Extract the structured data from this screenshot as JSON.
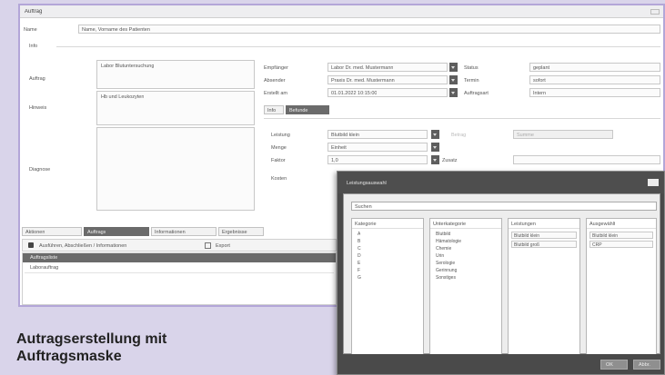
{
  "window": {
    "title": "Auftrag",
    "name_label": "Name",
    "name_value": "Name, Vorname des Patienten",
    "info_label": "Info",
    "auftrag_label": "Auftrag",
    "auftrag_value": "Labor Blutuntersuchung",
    "hinweis_label": "Hinweis",
    "hinweis_value": "Hb und Leukozyten",
    "diagnose_label": "Diagnose",
    "empfaenger_label": "Empfänger",
    "empfaenger_value": "Labor Dr. med. Mustermann",
    "absender_label": "Absender",
    "absender_value": "Praxis Dr. med. Mustermann",
    "erstellt_label": "Erstellt am",
    "erstellt_value": "01.01.2022 10:15:00",
    "status_label": "Status",
    "status_value": "geplant",
    "termin_label": "Termin",
    "termin_value": "sofort",
    "auftragsart_label": "Auftragsart",
    "auftragsart_value": "Intern",
    "tab_eins": "Info",
    "tab_zwei": "Befunde",
    "leistung_label": "Leistung",
    "leistung_value": "Blutbild klein",
    "menge_label": "Menge",
    "menge_value": "Einheit",
    "faktor_label": "Faktor",
    "faktor_value": "1,0",
    "betrag_label": "Betrag",
    "betrag_value": "Summe",
    "kosten_label": "Kosten",
    "zusatz_label": "Zusatz",
    "lower_tabs": [
      "Aktionen",
      "Auftrags",
      "Informationen",
      "Ergebnisse"
    ],
    "action_text": "Ausführen, Abschließen / Informationen",
    "export_label": "Export",
    "list_header": "Auftragsliste",
    "list_row": "Laborauftrag"
  },
  "caption": {
    "line1": "Autragserstellung mit",
    "line2": "Auftragsmaske"
  },
  "dialog": {
    "title": "Leistungsauswahl",
    "search_value": "Suchen",
    "columns": [
      {
        "header": "Kategorie",
        "items": [
          "A",
          "B",
          "C",
          "D",
          "E",
          "F",
          "G"
        ]
      },
      {
        "header": "Unterkategorie",
        "items": [
          "Blutbild",
          "Hämatologie",
          "Chemie",
          "Urin",
          "Serologie",
          "Gerinnung",
          "Sonstiges"
        ]
      },
      {
        "header": "Leistungen",
        "items": [
          "Blutbild klein",
          "Blutbild groß"
        ]
      },
      {
        "header": "Ausgewählt",
        "items": [
          "Blutbild klein",
          "CRP"
        ]
      }
    ],
    "ok_label": "OK",
    "cancel_label": "Abbr."
  }
}
